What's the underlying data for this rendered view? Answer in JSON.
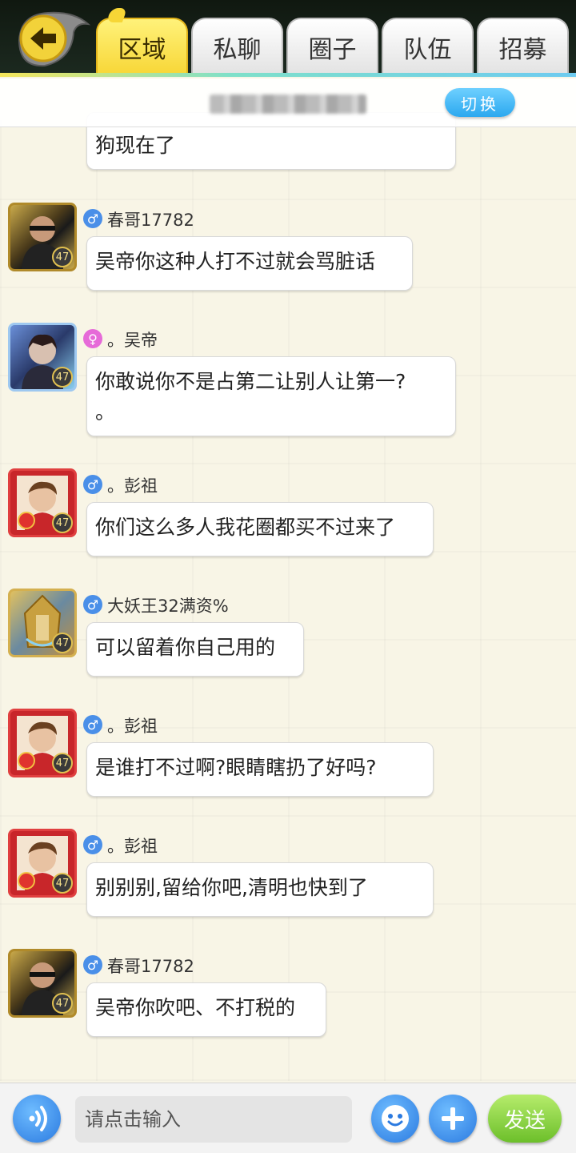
{
  "colors": {
    "accent": "#f7d636",
    "male": "#4a8fe8",
    "female": "#e66ad8",
    "send": "#6cbf2a",
    "icon_button": "#2b7ae0"
  },
  "header": {
    "back_icon": "back-arrow-icon",
    "tabs": [
      {
        "label": "区域",
        "active": true
      },
      {
        "label": "私聊",
        "active": false
      },
      {
        "label": "圈子",
        "active": false
      },
      {
        "label": "队伍",
        "active": false
      },
      {
        "label": "招募",
        "active": false
      }
    ],
    "switch_label": "切换"
  },
  "chat": {
    "partial_message": "狗现在了",
    "messages": [
      {
        "gender": "♂",
        "gender_type": "male",
        "name": "春哥17782",
        "level": "47",
        "text": "吴帝你这种人打不过就会骂脏话"
      },
      {
        "gender": "♀",
        "gender_type": "female",
        "name": "。吴帝",
        "level": "47",
        "text_lines": [
          "你敢说你不是占第二让别人让第一?",
          "。"
        ]
      },
      {
        "gender": "♂",
        "gender_type": "male",
        "name": "。彭祖",
        "level": "47",
        "text": "你们这么多人我花圈都买不过来了"
      },
      {
        "gender": "♂",
        "gender_type": "male",
        "name": "大妖王32满资%",
        "level": "47",
        "text": "可以留着你自己用的"
      },
      {
        "gender": "♂",
        "gender_type": "male",
        "name": "。彭祖",
        "level": "47",
        "text": "是谁打不过啊?眼睛瞎扔了好吗?"
      },
      {
        "gender": "♂",
        "gender_type": "male",
        "name": "。彭祖",
        "level": "47",
        "text": "别别别,留给你吧,清明也快到了"
      },
      {
        "gender": "♂",
        "gender_type": "male",
        "name": "春哥17782",
        "level": "47",
        "text": "吴帝你吹吧、不打税的"
      }
    ]
  },
  "footer": {
    "voice_icon": "voice-icon",
    "input_placeholder": "请点击输入",
    "emoji_icon": "emoji-icon",
    "plus_icon": "plus-icon",
    "send_label": "发送"
  }
}
